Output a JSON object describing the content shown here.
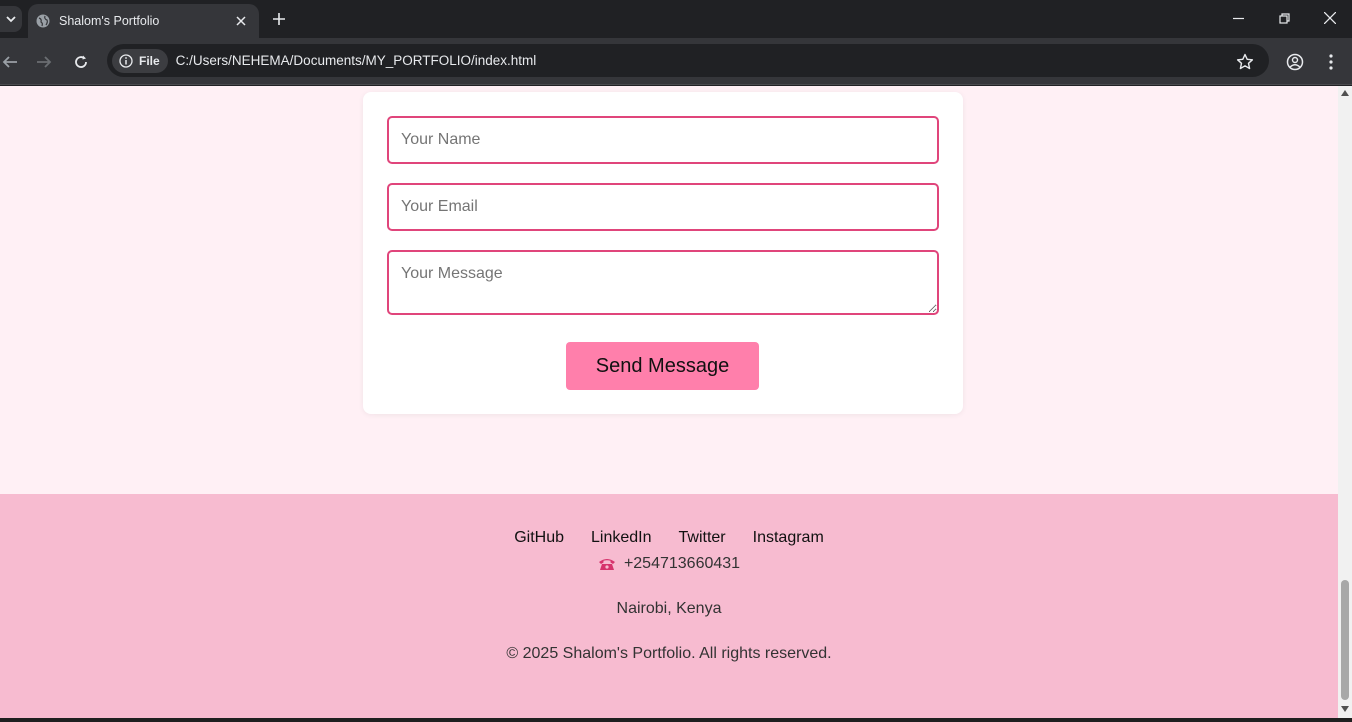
{
  "browser": {
    "tab_title": "Shalom's Portfolio",
    "site_chip": "File",
    "url": "C:/Users/NEHEMA/Documents/MY_PORTFOLIO/index.html"
  },
  "contact_form": {
    "name_placeholder": "Your Name",
    "email_placeholder": "Your Email",
    "message_placeholder": "Your Message",
    "send_label": "Send Message"
  },
  "footer": {
    "links": [
      {
        "label": "GitHub"
      },
      {
        "label": "LinkedIn"
      },
      {
        "label": "Twitter"
      },
      {
        "label": "Instagram"
      }
    ],
    "phone": "+254713660431",
    "location": "Nairobi, Kenya",
    "copyright": "© 2025 Shalom's Portfolio. All rights reserved."
  },
  "colors": {
    "page_bg": "#fff0f5",
    "accent_border": "#e0457b",
    "button_bg": "#ff7fab",
    "footer_bg": "#f7bbd0"
  }
}
